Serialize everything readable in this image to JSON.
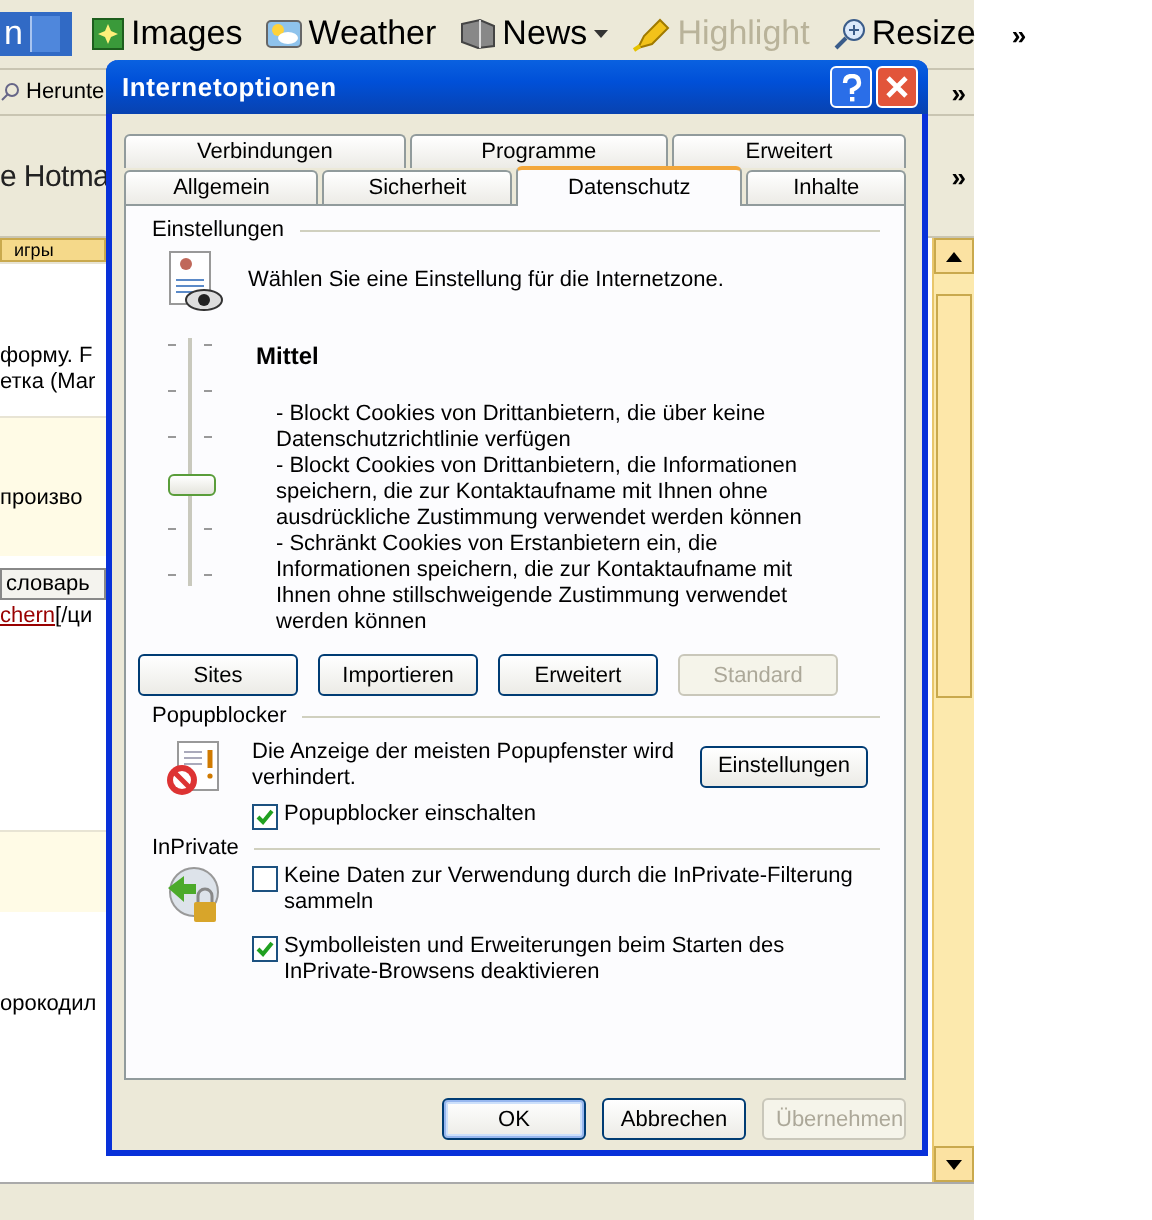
{
  "browser": {
    "toolbar": [
      {
        "kind": "search-menu",
        "label": "n"
      },
      {
        "kind": "images",
        "label": "Images",
        "disabled": false
      },
      {
        "kind": "weather",
        "label": "Weather",
        "disabled": false
      },
      {
        "kind": "news",
        "label": "News",
        "disabled": false
      },
      {
        "kind": "highlight",
        "label": "Highlight",
        "disabled": true
      },
      {
        "kind": "resize",
        "label": "Resize",
        "disabled": false
      }
    ],
    "toolbar_more": "»",
    "links_item": "Herunte",
    "links_more": "»",
    "address_text": "e Hotma",
    "address_more": "»",
    "page_tab": "игры",
    "page_lines": [
      "форму. F",
      "етка (Mar"
    ],
    "page_line_2": "произво",
    "word_button": "словарь",
    "page_link": "chern",
    "page_link_rest": "[/ци",
    "page_bottom": "орокодил"
  },
  "dialog": {
    "title": "Internetoptionen",
    "tabs_back": [
      {
        "label": "Verbindungen",
        "selected": false
      },
      {
        "label": "Programme",
        "selected": false
      },
      {
        "label": "Erweitert",
        "selected": false
      }
    ],
    "tabs_front": [
      {
        "label": "Allgemein",
        "selected": false
      },
      {
        "label": "Sicherheit",
        "selected": false
      },
      {
        "label": "Datenschutz",
        "selected": true
      },
      {
        "label": "Inhalte",
        "selected": false
      }
    ],
    "settings": {
      "heading": "Einstellungen",
      "intro": "Wählen Sie eine Einstellung für die Internetzone.",
      "level_name": "Mittel",
      "level": 0.4,
      "description": [
        "- Blockt Cookies von Drittanbietern, die über keine Datenschutzrichtlinie verfügen",
        "- Blockt Cookies von Drittanbietern, die Informationen speichern, die zur Kontaktaufname mit Ihnen ohne ausdrückliche Zustimmung verwendet werden können",
        "- Schränkt Cookies von Erstanbietern ein, die Informationen speichern, die zur Kontaktaufname mit Ihnen ohne stillschweigende Zustimmung verwendet werden können"
      ],
      "buttons": [
        {
          "label": "Sites",
          "disabled": false
        },
        {
          "label": "Importieren",
          "disabled": false
        },
        {
          "label": "Erweitert",
          "disabled": false
        },
        {
          "label": "Standard",
          "disabled": true
        }
      ]
    },
    "popup": {
      "heading": "Popupblocker",
      "text": "Die Anzeige der meisten Popupfenster wird verhindert.",
      "button": "Einstellungen",
      "checkbox": {
        "label": "Popupblocker einschalten",
        "checked": true
      }
    },
    "inprivate": {
      "heading": "InPrivate",
      "checkboxes": [
        {
          "label": "Keine Daten zur Verwendung durch die InPrivate-Filterung sammeln",
          "checked": false
        },
        {
          "label": "Symbolleisten und Erweiterungen beim Starten des InPrivate-Browsens deaktivieren",
          "checked": true
        }
      ]
    },
    "footer": [
      {
        "label": "OK",
        "default": true,
        "disabled": false
      },
      {
        "label": "Abbrechen",
        "default": false,
        "disabled": false
      },
      {
        "label": "Übernehmen",
        "default": false,
        "disabled": true
      }
    ]
  }
}
